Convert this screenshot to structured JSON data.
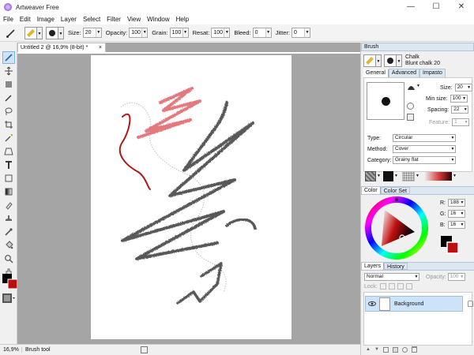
{
  "window": {
    "title": "Artweaver Free",
    "buttons": [
      "—",
      "☐",
      "✕"
    ]
  },
  "menu": [
    "File",
    "Edit",
    "Image",
    "Layer",
    "Select",
    "Filter",
    "View",
    "Window",
    "Help"
  ],
  "options": {
    "size": {
      "label": "Size:",
      "value": "20"
    },
    "opacity": {
      "label": "Opacity:",
      "value": "100"
    },
    "grain": {
      "label": "Grain:",
      "value": "100"
    },
    "resat": {
      "label": "Resat:",
      "value": "100"
    },
    "bleed": {
      "label": "Bleed:",
      "value": "0"
    },
    "jitter": {
      "label": "Jitter:",
      "value": "0"
    }
  },
  "document": {
    "tab_title": "Untitled 2 @ 16,9% (8-bit) *",
    "close": "×"
  },
  "status": {
    "zoom": "16,9%",
    "message": "Brush tool"
  },
  "brush_panel": {
    "title": "Brush",
    "category_name": "Chalk",
    "variant_name": "Blunt chalk 20",
    "tabs": [
      "General",
      "Advanced",
      "Impasto"
    ],
    "size": {
      "label": "Size:",
      "value": "20"
    },
    "min_size": {
      "label": "Min size:",
      "value": "100"
    },
    "spacing": {
      "label": "Spacing:",
      "value": "22"
    },
    "feature": {
      "label": "Feature:",
      "value": "1"
    },
    "type": {
      "label": "Type:",
      "value": "Circular"
    },
    "method": {
      "label": "Method:",
      "value": "Cover"
    },
    "category": {
      "label": "Category:",
      "value": "Grainy flat"
    }
  },
  "color_panel": {
    "tabs": [
      "Color",
      "Color Set"
    ],
    "r": {
      "label": "R:",
      "value": "188"
    },
    "g": {
      "label": "G:",
      "value": "16"
    },
    "b": {
      "label": "B:",
      "value": "16"
    },
    "primary": "#bc1010",
    "secondary": "#000000"
  },
  "layers_panel": {
    "tabs": [
      "Layers",
      "History"
    ],
    "blend_mode": "Normal",
    "opacity": {
      "label": "Opacity:",
      "value": "100"
    },
    "lock_label": "Lock:",
    "layers": [
      {
        "name": "Background"
      }
    ]
  },
  "colors": {
    "accent": "#7fb3e0",
    "selection": "#cde3f7",
    "red_stroke": "#b01818",
    "pink_stroke": "#e06a72"
  }
}
